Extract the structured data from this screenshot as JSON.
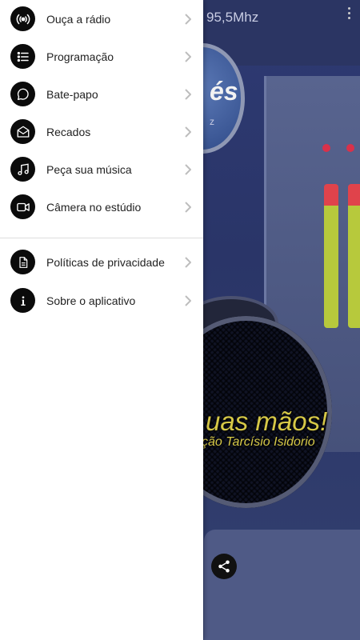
{
  "background": {
    "header_title": "95,5Mhz",
    "logo_text": "és",
    "logo_subtext": "z",
    "slogan": "uas mãos!",
    "slogan_sub": "ção Tarcísio Isidorio"
  },
  "drawer": {
    "primary_items": [
      {
        "label": "Ouça a rádio",
        "icon": "broadcast-icon"
      },
      {
        "label": "Programação",
        "icon": "list-icon"
      },
      {
        "label": "Bate-papo",
        "icon": "chat-bubble-icon"
      },
      {
        "label": "Recados",
        "icon": "envelope-icon"
      },
      {
        "label": "Peça sua música",
        "icon": "music-note-icon"
      },
      {
        "label": "Câmera no estúdio",
        "icon": "video-camera-icon"
      }
    ],
    "secondary_items": [
      {
        "label": "Políticas de privacidade",
        "icon": "document-icon"
      },
      {
        "label": "Sobre o aplicativo",
        "icon": "info-icon"
      }
    ]
  },
  "colors": {
    "drawer_bg": "#ffffff",
    "icon_bg": "#0b0b0b",
    "chevron": "#bdbdbd",
    "slogan": "#d6c847"
  }
}
